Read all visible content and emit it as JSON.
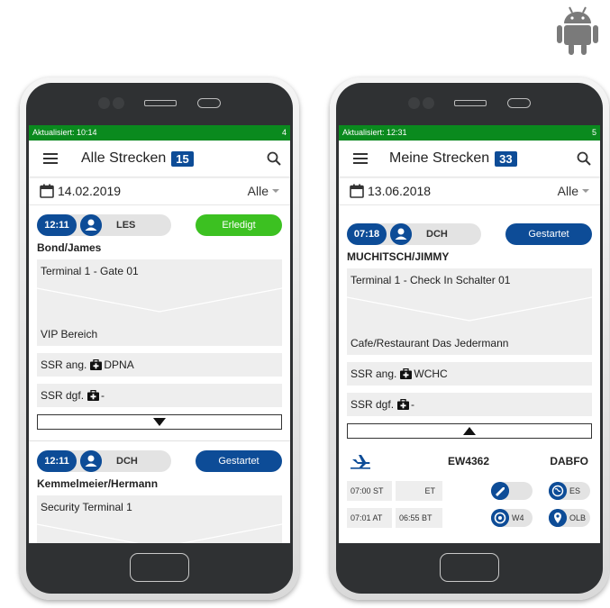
{
  "left_phone": {
    "status": {
      "updated": "Aktualisiert: 10:14",
      "count": "4"
    },
    "appbar": {
      "title": "Alle Strecken",
      "badge": "15"
    },
    "datebar": {
      "date": "14.02.2019",
      "filter": "Alle"
    },
    "cards": [
      {
        "time": "12:11",
        "station": "LES",
        "status": "Erledigt",
        "name": "Bond/James",
        "from": "Terminal 1 - Gate 01",
        "to": "VIP Bereich",
        "ssr_ang_label": "SSR ang.",
        "ssr_ang_value": "DPNA",
        "ssr_dgf_label": "SSR dgf.",
        "ssr_dgf_value": "-"
      },
      {
        "time": "12:11",
        "station": "DCH",
        "status": "Gestartet",
        "name": "Kemmelmeier/Hermann",
        "from": "Security Terminal 1"
      }
    ]
  },
  "right_phone": {
    "status": {
      "updated": "Aktualisiert: 12:31",
      "count": "5"
    },
    "appbar": {
      "title": "Meine Strecken",
      "badge": "33"
    },
    "datebar": {
      "date": "13.06.2018",
      "filter": "Alle"
    },
    "card": {
      "time": "07:18",
      "station": "DCH",
      "status": "Gestartet",
      "name": "MUCHITSCH/JIMMY",
      "from": "Terminal 1 - Check In Schalter 01",
      "to": "Cafe/Restaurant Das Jedermann",
      "ssr_ang_label": "SSR ang.",
      "ssr_ang_value": "WCHC",
      "ssr_dgf_label": "SSR dgf.",
      "ssr_dgf_value": "-"
    },
    "flight": {
      "number": "EW4362",
      "aircraft": "DABFO",
      "st": "07:00 ST",
      "et": "ET",
      "es": "ES",
      "at": "07:01 AT",
      "bt": "06:55 BT",
      "w4": "W4",
      "olb": "OLB"
    }
  },
  "colors": {
    "primary": "#0d4c97",
    "statusbar": "#0a8a1e",
    "done": "#3cc121",
    "android": "#7a7a7a"
  },
  "icons": [
    "android-icon",
    "menu-icon",
    "search-icon",
    "calendar-icon",
    "person-icon",
    "medical-bag-icon",
    "plane-icon",
    "takeoff-icon",
    "globe-icon",
    "target-icon",
    "location-pin-icon"
  ]
}
